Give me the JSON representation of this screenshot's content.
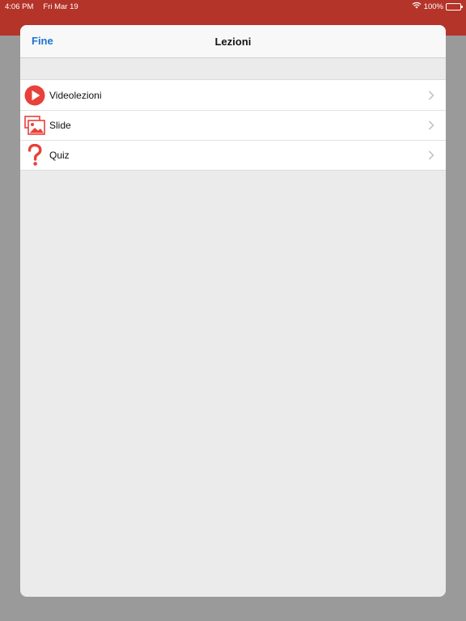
{
  "status_bar": {
    "time": "4:06 PM",
    "date": "Fri Mar 19",
    "battery": "100%",
    "icons": [
      "wifi-icon",
      "battery-icon"
    ]
  },
  "nav": {
    "done_label": "Fine",
    "title": "Lezioni"
  },
  "menu": {
    "items": [
      {
        "label": "Videolezioni",
        "icon": "play-circle-icon"
      },
      {
        "label": "Slide",
        "icon": "image-gallery-icon"
      },
      {
        "label": "Quiz",
        "icon": "question-mark-icon"
      }
    ]
  },
  "colors": {
    "accent_red": "#e8413a",
    "link_blue": "#1a73d4",
    "header_red_dimmed": "#b4342a",
    "sheet_background": "#ebebeb"
  }
}
